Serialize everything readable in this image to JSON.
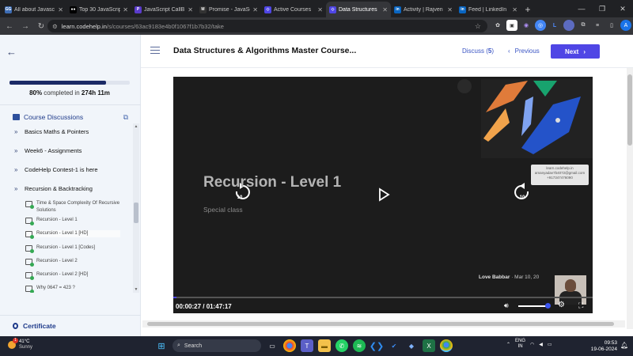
{
  "browser": {
    "tabs": [
      {
        "label": "All about Javasc",
        "icon": "gg-icon",
        "color": "#3d6db5",
        "glyph": "GG"
      },
      {
        "label": "Top 30 JavaScrip",
        "icon": "medium-icon",
        "color": "#000000",
        "glyph": "●●"
      },
      {
        "label": "JavaScript CallB",
        "icon": "p-icon",
        "color": "#5b3ccc",
        "glyph": "P"
      },
      {
        "label": "Promise - JavaSc",
        "icon": "m-icon",
        "color": "#333333",
        "glyph": "M"
      },
      {
        "label": "Active Courses",
        "icon": "codehelp-icon",
        "color": "#4f46e5",
        "glyph": "◇"
      },
      {
        "label": "Data Structures",
        "icon": "codehelp-icon",
        "color": "#4f46e5",
        "glyph": "◇",
        "active": true
      },
      {
        "label": "Activity | Rajven",
        "icon": "linkedin-icon",
        "color": "#0a66c2",
        "glyph": "in"
      },
      {
        "label": "Feed | LinkedIn",
        "icon": "linkedin-icon",
        "color": "#0a66c2",
        "glyph": "in"
      }
    ],
    "new_tab": "+",
    "url_domain": "learn.codehelp.in",
    "url_path": "/s/courses/63ac9183e4b0f1067f1b7b32/take"
  },
  "sidebar": {
    "progress_percent": 80,
    "progress_pct_text": "80%",
    "progress_mid": " completed in ",
    "progress_time": "274h 11m",
    "discussions_label": "Course Discussions",
    "sections": [
      {
        "label": "Basics Maths & Pointers",
        "chevron": "»"
      },
      {
        "label": "Week6 - Assignments",
        "chevron": "»"
      },
      {
        "label": "CodeHelp Contest-1 is here",
        "chevron": "»"
      },
      {
        "label": "Recursion & Backtracking",
        "chevron": "»"
      }
    ],
    "lessons": [
      {
        "label": "Time & Space Complexity Of Recursive Solutions"
      },
      {
        "label": "Recursion - Level 1"
      },
      {
        "label": "Recursion - Level 1 [HD]",
        "selected": true
      },
      {
        "label": "Recursion - Level 1 [Codes]"
      },
      {
        "label": "Recursion - Level 2"
      },
      {
        "label": "Recursion - Level 2 [HD]"
      },
      {
        "label": "Why 0647 = 423 ?"
      }
    ],
    "certificate_label": "Certificate"
  },
  "header": {
    "title": "Data Structures & Algorithms Master Course...",
    "discuss_label": "Discuss (",
    "discuss_count": "5",
    "discuss_close": ")",
    "previous_label": "Previous",
    "next_label": "Next"
  },
  "video": {
    "title": "Recursion - Level 1",
    "subtitle": "Special class",
    "author": "Love Babbar",
    "date": "· Mar 10, 20",
    "skip_seconds": "10",
    "watermark": [
      "learn.codehelp.in",
      "amanyadav7b4072@gmail.com",
      "+917347476090"
    ],
    "current_time": "00:00:27",
    "duration": "/ 01:47:17",
    "progress_fraction": 0.0042,
    "volume_fraction": 1.0
  },
  "taskbar": {
    "weather_temp": "41°C",
    "weather_desc": "Sunny",
    "search_label": "Search",
    "lang_line1": "ENG",
    "lang_line2": "IN",
    "time": "09:53",
    "date": "19-06-2024",
    "notification_count": "1"
  },
  "colors": {
    "accent": "#4f46e5",
    "sidebar_bg": "#f1f5fa",
    "progress": "#1b2a66",
    "player_bg": "#1c1c1c"
  }
}
